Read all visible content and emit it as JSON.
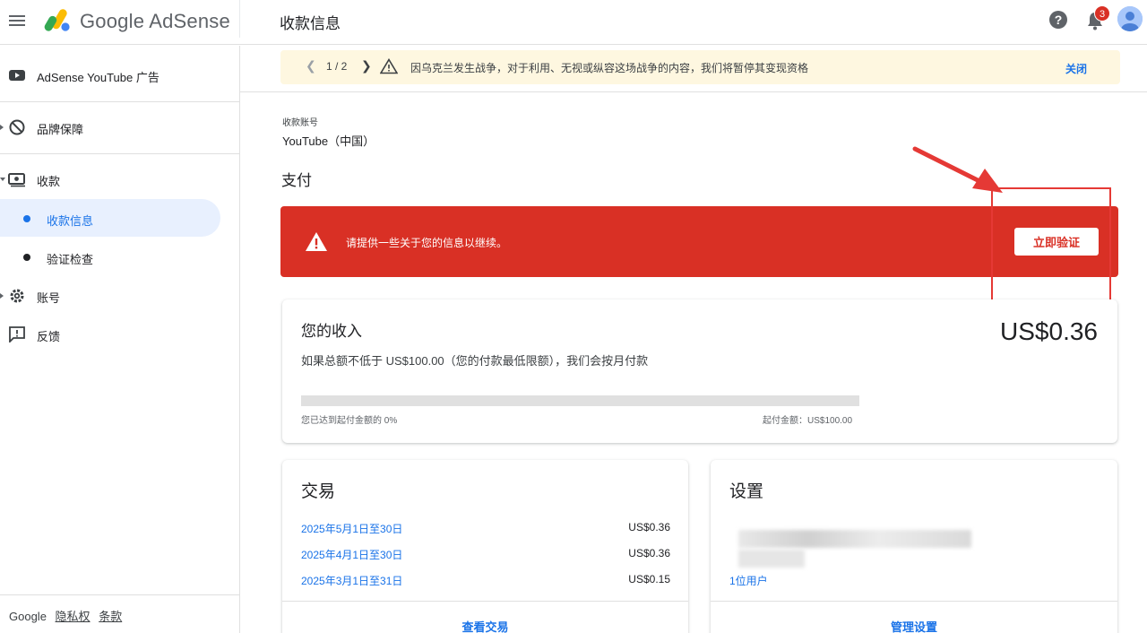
{
  "header": {
    "brand": "Google AdSense",
    "page_title": "收款信息",
    "help_glyph": "?",
    "notification_count": "3"
  },
  "sidebar": {
    "items": [
      {
        "label": "AdSense YouTube 广告",
        "icon": "youtube-icon"
      },
      {
        "label": "品牌保障",
        "icon": "block-icon"
      },
      {
        "label": "收款",
        "icon": "payments-icon"
      },
      {
        "label": "账号",
        "icon": "gear-icon"
      },
      {
        "label": "反馈",
        "icon": "feedback-icon"
      }
    ],
    "sub_items": [
      {
        "label": "收款信息",
        "active": true
      },
      {
        "label": "验证检查",
        "active": false
      }
    ],
    "footer": {
      "brand": "Google",
      "privacy": "隐私权",
      "terms": "条款"
    }
  },
  "banner": {
    "pager": "1 / 2",
    "message": "因乌克兰发生战争，对于利用、无视或纵容这场战争的内容，我们将暂停其变现资格",
    "close": "关闭"
  },
  "account": {
    "label": "收款账号",
    "value": "YouTube（中国）"
  },
  "payment": {
    "section_title": "支付",
    "alert_message": "请提供一些关于您的信息以继续。",
    "verify_button": "立即验证"
  },
  "earnings": {
    "title": "您的收入",
    "amount": "US$0.36",
    "description": "如果总额不低于 US$100.00（您的付款最低限额），我们会按月付款",
    "progress_percent": 0,
    "progress_left": "您已达到起付金额的 0%",
    "progress_right": "起付金额：US$100.00"
  },
  "transactions": {
    "title": "交易",
    "rows": [
      {
        "date": "2025年5月1日至30日",
        "amount": "US$0.36"
      },
      {
        "date": "2025年4月1日至30日",
        "amount": "US$0.36"
      },
      {
        "date": "2025年3月1日至31日",
        "amount": "US$0.15"
      }
    ],
    "view_link": "查看交易"
  },
  "settings": {
    "title": "设置",
    "users_link": "1位用户",
    "manage_link": "管理设置"
  },
  "colors": {
    "accent": "#1a73e8",
    "alert_red": "#d93025",
    "banner_bg": "#fef7e0",
    "annotation": "#e53935"
  }
}
